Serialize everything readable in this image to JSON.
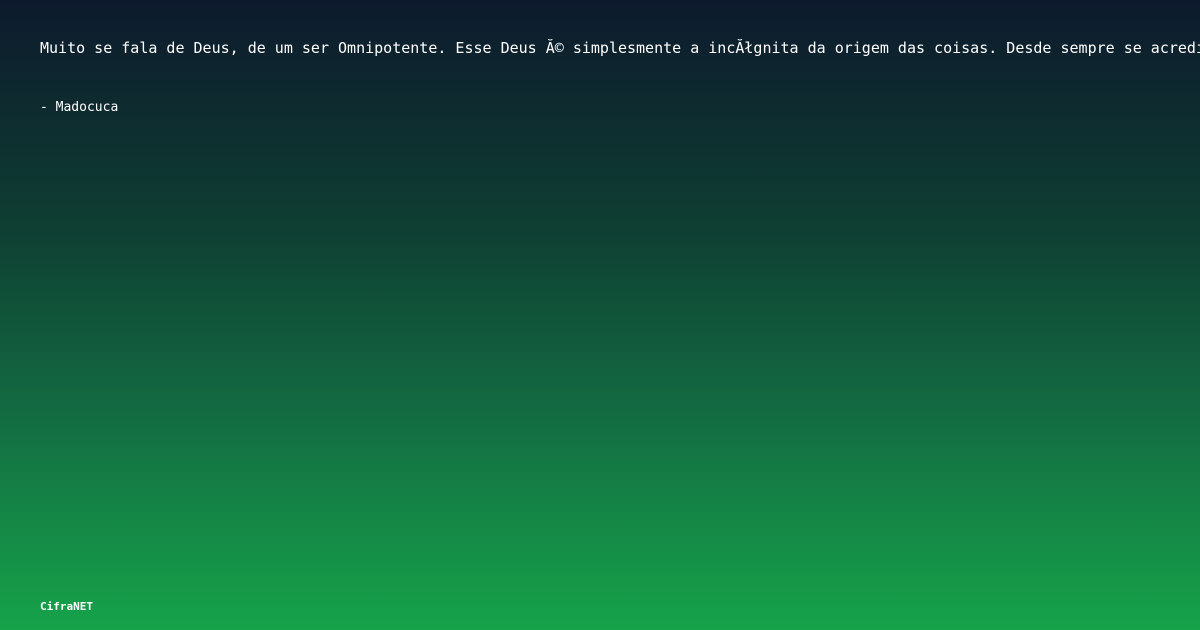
{
  "quote": {
    "text": "Muito se fala de Deus, de um ser Omnipotente. Esse Deus Ă© simplesmente a incĂłgnita da origem das coisas. Desde sempre se acredita"
  },
  "author": {
    "text": "- Madocuca"
  },
  "brand": {
    "name": "CifraNET"
  }
}
